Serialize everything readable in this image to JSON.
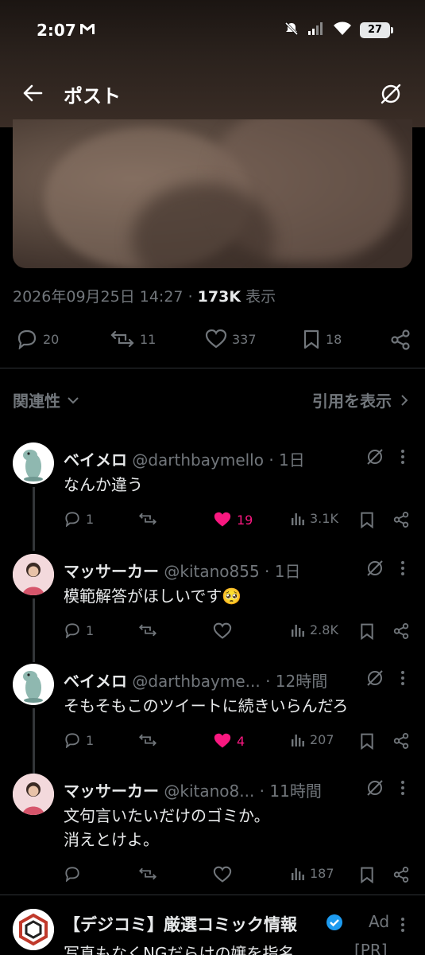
{
  "status_bar": {
    "time": "2:07",
    "battery": "27"
  },
  "header": {
    "title": "ポスト"
  },
  "post": {
    "timestamp": "2026年09月25日 14:27",
    "separator": "·",
    "views_count": "173K",
    "views_label": "表示",
    "replies": "20",
    "reposts": "11",
    "likes": "337",
    "bookmarks": "18"
  },
  "sort": {
    "label": "関連性",
    "quotes_link": "引用を表示"
  },
  "replies": [
    {
      "name": "ベイメロ",
      "handle": "@darthbaymello",
      "time": "· 1日",
      "text": "なんか違う",
      "replies": "1",
      "likes": "19",
      "liked": true,
      "views": "3.1K"
    },
    {
      "name": "マッサーカー",
      "handle": "@kitano855",
      "time": "· 1日",
      "text": "模範解答がほしいです🥺",
      "replies": "1",
      "likes": "",
      "liked": false,
      "views": "2.8K"
    },
    {
      "name": "ベイメロ",
      "handle": "@darthbayme...",
      "time": "· 12時間",
      "text": "そもそもこのツイートに続きいらんだろ",
      "replies": "1",
      "likes": "4",
      "liked": true,
      "views": "207"
    },
    {
      "name": "マッサーカー",
      "handle": "@kitano8...",
      "time": "· 11時間",
      "text_line1": "文句言いたいだけのゴミか。",
      "text_line2": "消えとけよ。",
      "replies": "",
      "likes": "",
      "liked": false,
      "views": "187"
    }
  ],
  "ad": {
    "name": "【デジコミ】厳選コミック情報",
    "tag": "Ad",
    "teaser": "写真もなくNGだらけの嬢を指名...",
    "pr": "[PR]"
  },
  "colors": {
    "like_pink": "#f91880",
    "muted": "#71767b",
    "verified_blue": "#1d9bf0"
  }
}
